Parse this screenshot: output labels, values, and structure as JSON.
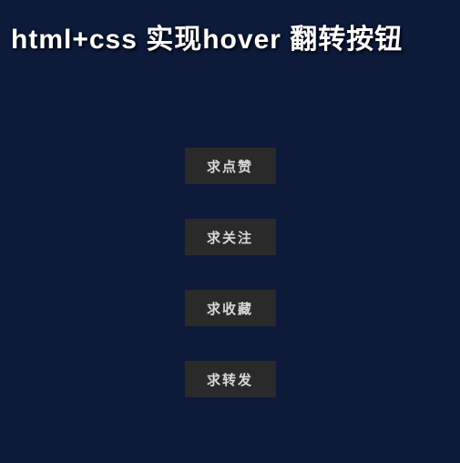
{
  "title": "html+css 实现hover 翻转按钮",
  "buttons": [
    {
      "label": "求点赞"
    },
    {
      "label": "求关注"
    },
    {
      "label": "求收藏"
    },
    {
      "label": "求转发"
    }
  ]
}
